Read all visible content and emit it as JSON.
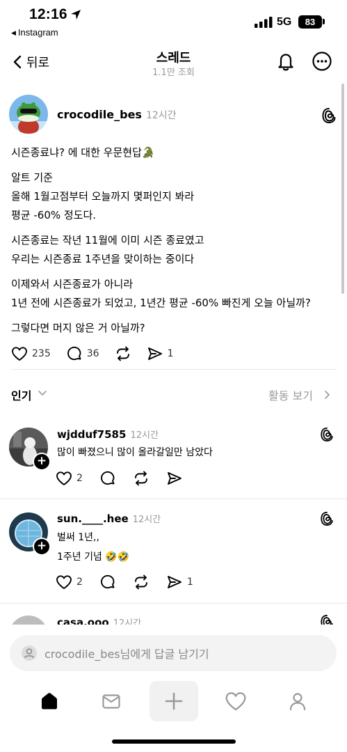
{
  "status_bar": {
    "time": "12:16",
    "back_app": "Instagram",
    "network": "5G",
    "battery": "83"
  },
  "nav": {
    "back_label": "뒤로",
    "title": "스레드",
    "subtitle": "1.1만 조회"
  },
  "post": {
    "author": "crocodile_bes",
    "time": "12시간",
    "paragraphs": [
      [
        "시즌종료냐? 에 대한 우문현답🐊"
      ],
      [
        "알트 기준",
        "올해 1월고점부터 오늘까지 몇퍼인지 봐라",
        "평균 -60% 정도다."
      ],
      [
        "시즌종료는 작년 11월에 이미 시즌 종료였고",
        "우리는 시즌종료 1주년을 맞이하는 중이다"
      ],
      [
        "이제와서 시즌종료가 아니라",
        "1년 전에 시즌종료가 되었고, 1년간 평균 -60% 빠진게 오늘 아닐까?"
      ],
      [
        "그렇다면 머지 않은 거 아닐까?"
      ]
    ],
    "likes": "235",
    "comments": "36",
    "shares": "1"
  },
  "filter": {
    "label": "인기",
    "activity": "활동 보기"
  },
  "replies": [
    {
      "author": "wjdduf7585",
      "time": "12시간",
      "lines": [
        "많이 빠졌으니 많이 올라갈일만 남았다"
      ],
      "likes": "2",
      "shares": ""
    },
    {
      "author": "sun.____.hee",
      "time": "12시간",
      "lines": [
        "벌써 1년,,",
        "1주년 기념 🤣🤣"
      ],
      "likes": "2",
      "shares": "1"
    },
    {
      "author": "casa.ooo",
      "time": "12시간",
      "lines": [],
      "likes": "",
      "shares": ""
    }
  ],
  "composer": {
    "placeholder": "crocodile_bes님에게 답글 남기기"
  },
  "tabs": [
    "home-icon",
    "inbox-icon",
    "create-icon",
    "activity-heart-icon",
    "profile-icon"
  ]
}
